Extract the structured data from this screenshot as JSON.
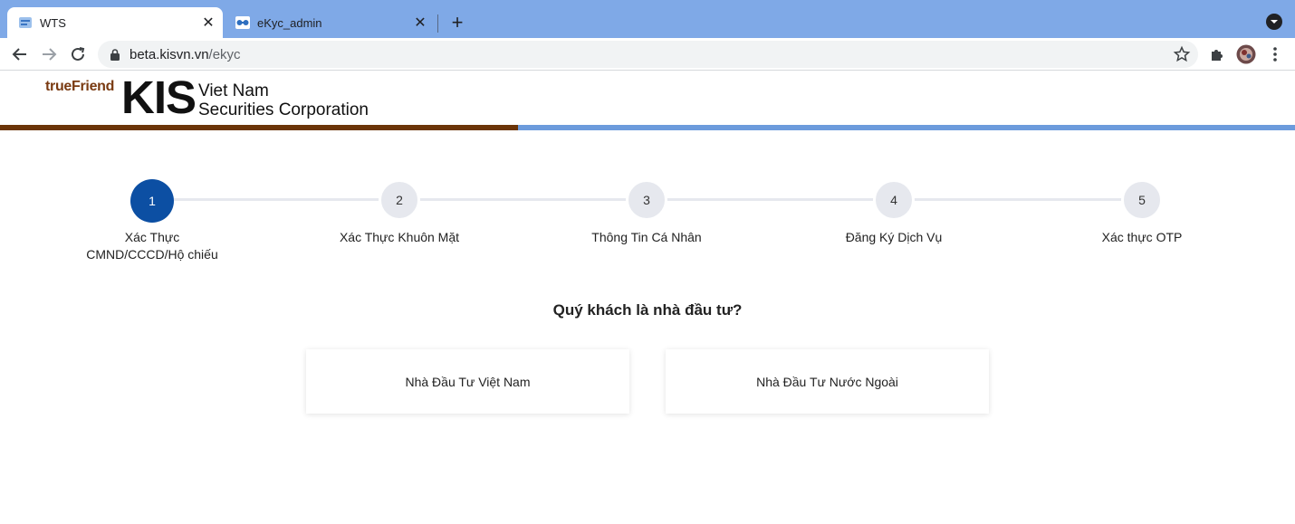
{
  "browser": {
    "tabs": [
      {
        "title": "WTS",
        "active": true
      },
      {
        "title": "eKyc_admin",
        "active": false
      }
    ],
    "url_host": "beta.kisvn.vn",
    "url_path": "/ekyc"
  },
  "header": {
    "brand_truefriend": "trueFriend",
    "brand_kis": "KIS",
    "brand_line1": "Viet Nam",
    "brand_line2": "Securities Corporation",
    "colors": {
      "bar_left": "#6b3408",
      "bar_right": "#6c9bdc",
      "accent": "#0c4fa3"
    }
  },
  "stepper": {
    "steps": [
      {
        "number": "1",
        "label_line1": "Xác Thực",
        "label_line2": "CMND/CCCD/Hộ chiếu",
        "active": true
      },
      {
        "number": "2",
        "label_line1": "Xác Thực Khuôn Mặt",
        "label_line2": "",
        "active": false
      },
      {
        "number": "3",
        "label_line1": "Thông Tin Cá Nhân",
        "label_line2": "",
        "active": false
      },
      {
        "number": "4",
        "label_line1": "Đăng Ký Dịch Vụ",
        "label_line2": "",
        "active": false
      },
      {
        "number": "5",
        "label_line1": "Xác thực OTP",
        "label_line2": "",
        "active": false
      }
    ]
  },
  "question": "Quý khách là nhà đầu tư?",
  "choices": {
    "domestic": "Nhà Đầu Tư Việt Nam",
    "foreign": "Nhà Đầu Tư Nước Ngoài"
  }
}
